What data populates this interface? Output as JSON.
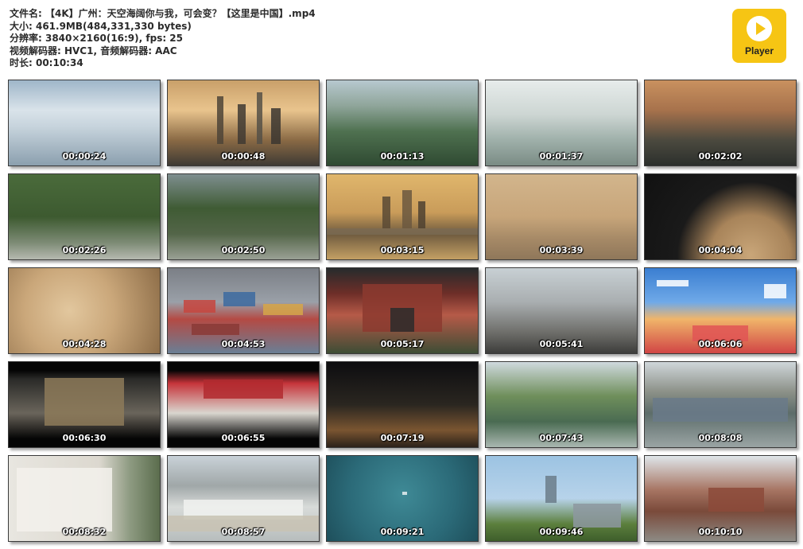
{
  "info": {
    "filename": "文件名: 【4K】广州：天空海阔你与我，可会变？【这里是中国】.mp4",
    "size": "大小: 461.9MB(484,331,330 bytes)",
    "resolution": "分辨率: 3840×2160(16:9), fps: 25",
    "codec": "视频解码器: HVC1, 音频解码器: AAC",
    "duration": "时长: 00:10:34"
  },
  "logo": {
    "label": "Player",
    "color": "#f6c514"
  },
  "thumbnails": [
    {
      "time": "00:00:24",
      "scene": "clouds"
    },
    {
      "time": "00:00:48",
      "scene": "skyline-sunrise"
    },
    {
      "time": "00:01:13",
      "scene": "mountains-mist"
    },
    {
      "time": "00:01:37",
      "scene": "waterfall"
    },
    {
      "time": "00:02:02",
      "scene": "sunset-valley"
    },
    {
      "time": "00:02:26",
      "scene": "forest-road"
    },
    {
      "time": "00:02:50",
      "scene": "forest-bridge"
    },
    {
      "time": "00:03:15",
      "scene": "city-river-gold"
    },
    {
      "time": "00:03:39",
      "scene": "city-haze"
    },
    {
      "time": "00:04:04",
      "scene": "globe-dark"
    },
    {
      "time": "00:04:28",
      "scene": "globe-map"
    },
    {
      "time": "00:04:53",
      "scene": "containers"
    },
    {
      "time": "00:05:17",
      "scene": "red-gate"
    },
    {
      "time": "00:05:41",
      "scene": "old-street"
    },
    {
      "time": "00:06:06",
      "scene": "animation"
    },
    {
      "time": "00:06:30",
      "scene": "meeting"
    },
    {
      "time": "00:06:55",
      "scene": "canton-fair"
    },
    {
      "time": "00:07:19",
      "scene": "night-street"
    },
    {
      "time": "00:07:43",
      "scene": "garden-lake"
    },
    {
      "time": "00:08:08",
      "scene": "temple-roof"
    },
    {
      "time": "00:08:32",
      "scene": "memorial-wall"
    },
    {
      "time": "00:08:57",
      "scene": "station-aerial"
    },
    {
      "time": "00:09:21",
      "scene": "sea-boat"
    },
    {
      "time": "00:09:46",
      "scene": "heron"
    },
    {
      "time": "00:10:10",
      "scene": "pavilion"
    }
  ]
}
